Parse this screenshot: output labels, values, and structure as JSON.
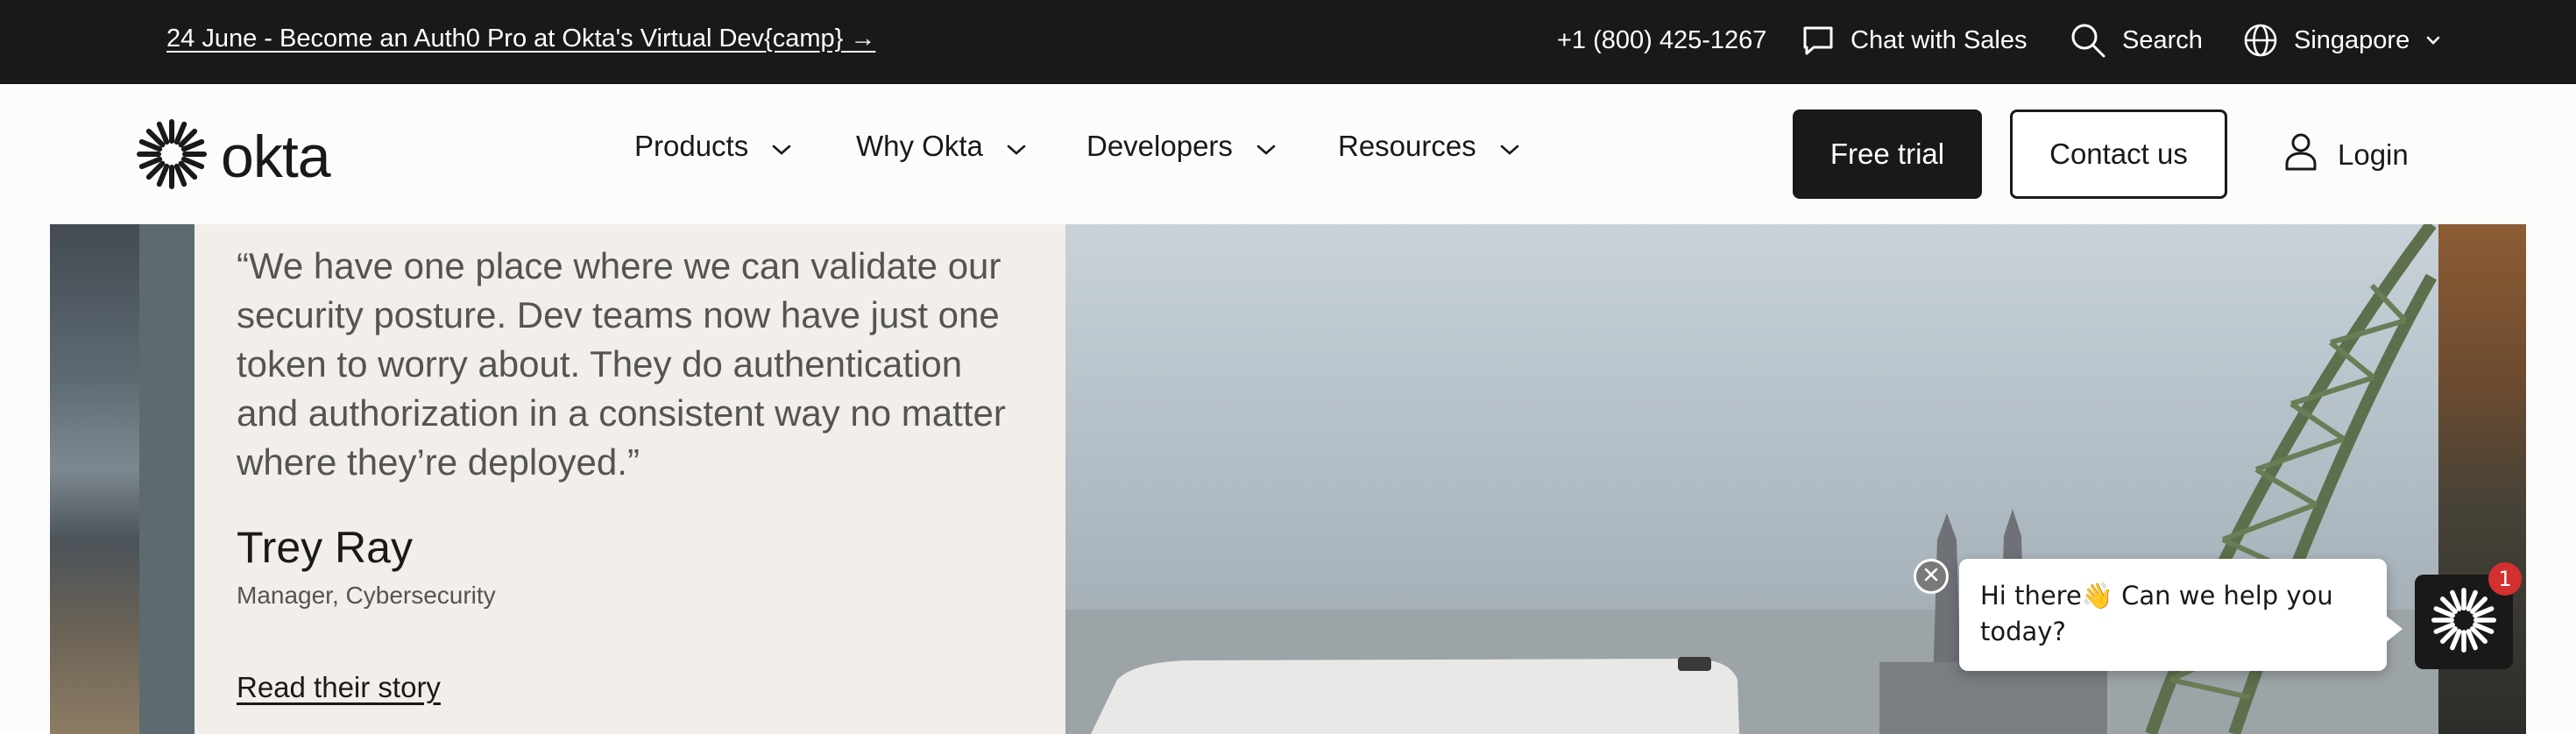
{
  "topbar": {
    "promo": "24 June - Become an Auth0 Pro at Okta's Virtual Dev{camp} →",
    "phone": "+1 (800) 425-1267",
    "chat_sales": "Chat with Sales",
    "search": "Search",
    "region": "Singapore"
  },
  "nav": {
    "logo": "okta",
    "items": [
      {
        "label": "Products"
      },
      {
        "label": "Why Okta"
      },
      {
        "label": "Developers"
      },
      {
        "label": "Resources"
      }
    ],
    "free_trial": "Free trial",
    "contact_us": "Contact us",
    "login": "Login"
  },
  "testimonial": {
    "quote": "“We have one place where we can validate our security posture. Dev teams now have just one token to worry about. They do authentication and authorization in a consistent way no matter where they’re deployed.”",
    "name": "Trey Ray",
    "role": "Manager, Cybersecurity",
    "cta": "Read their story"
  },
  "chat": {
    "message": "Hi there👋 Can we help you today?",
    "badge_count": "1"
  },
  "icons": [
    "chat-icon",
    "search-icon",
    "globe-icon",
    "chevron-down-icon",
    "user-icon",
    "okta-sunburst-icon",
    "close-icon"
  ]
}
